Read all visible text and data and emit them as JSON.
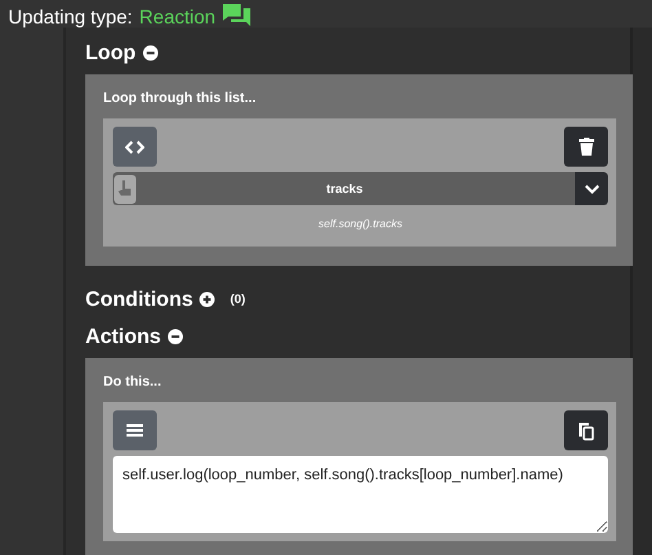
{
  "header": {
    "label": "Updating type:",
    "type": "Reaction"
  },
  "sections": [
    {
      "kind": "loop",
      "title": "Loop",
      "expanded": true,
      "card_title": "Loop through this list...",
      "select": {
        "value": "tracks"
      },
      "caption": "self.song().tracks"
    },
    {
      "kind": "conditions",
      "title": "Conditions",
      "expanded": false,
      "count": "(0)"
    },
    {
      "kind": "actions",
      "title": "Actions",
      "expanded": true,
      "card_title": "Do this...",
      "code": "self.user.log(loop_number, self.song().tracks[loop_number].name)"
    }
  ]
}
